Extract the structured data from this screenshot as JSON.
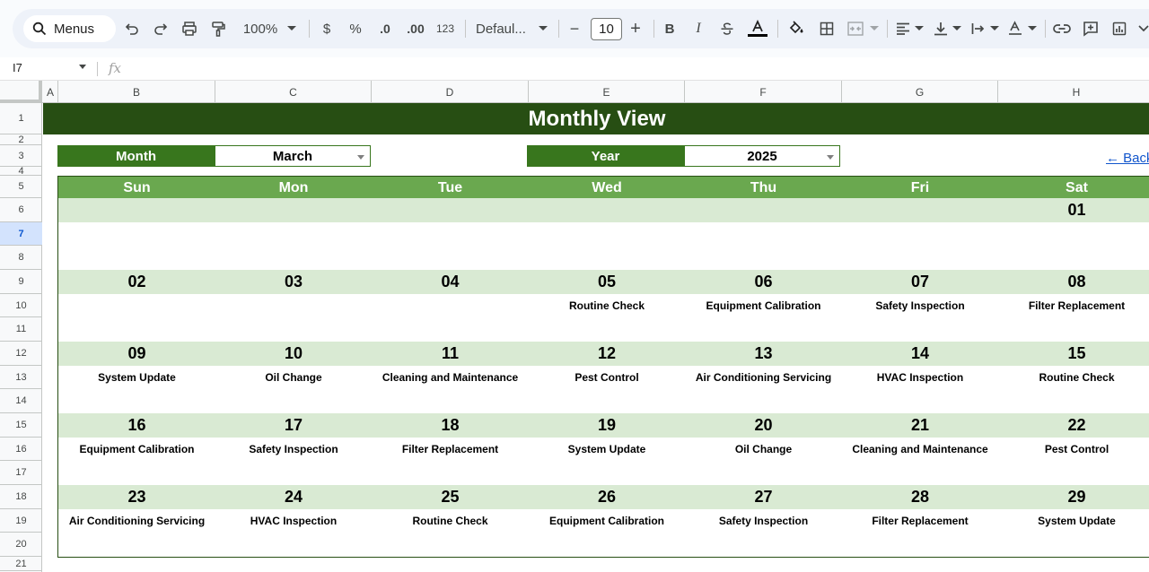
{
  "toolbar": {
    "menus_label": "Menus",
    "zoom": "100%",
    "currency": "$",
    "percent": "%",
    "decrease_decimal": ".0",
    "increase_decimal": ".00",
    "number_format": "123",
    "font_family": "Defaul...",
    "font_size": "10",
    "minus": "−",
    "plus": "+",
    "bold": "B",
    "italic": "I"
  },
  "formula_bar": {
    "name_box": "I7",
    "fx": "fx"
  },
  "columns": [
    "A",
    "B",
    "C",
    "D",
    "E",
    "F",
    "G",
    "H"
  ],
  "rows": [
    "1",
    "2",
    "3",
    "4",
    "5",
    "6",
    "7",
    "8",
    "9",
    "10",
    "11",
    "12",
    "13",
    "14",
    "15",
    "16",
    "17",
    "18",
    "19",
    "20",
    "21"
  ],
  "selected_row": "7",
  "sheet": {
    "title": "Monthly View",
    "month_label": "Month",
    "month_value": "March",
    "year_label": "Year",
    "year_value": "2025",
    "back_link": "← Back"
  },
  "calendar": {
    "days": [
      "Sun",
      "Mon",
      "Tue",
      "Wed",
      "Thu",
      "Fri",
      "Sat"
    ],
    "weeks": [
      {
        "dates": [
          "",
          "",
          "",
          "",
          "",
          "",
          "01"
        ],
        "events": [
          "",
          "",
          "",
          "",
          "",
          "",
          ""
        ]
      },
      {
        "dates": [
          "02",
          "03",
          "04",
          "05",
          "06",
          "07",
          "08"
        ],
        "events": [
          "",
          "",
          "",
          "Routine Check",
          "Equipment Calibration",
          "Safety Inspection",
          "Filter Replacement"
        ]
      },
      {
        "dates": [
          "09",
          "10",
          "11",
          "12",
          "13",
          "14",
          "15"
        ],
        "events": [
          "System Update",
          "Oil Change",
          "Cleaning and Maintenance",
          "Pest Control",
          "Air Conditioning Servicing",
          "HVAC Inspection",
          "Routine Check"
        ]
      },
      {
        "dates": [
          "16",
          "17",
          "18",
          "19",
          "20",
          "21",
          "22"
        ],
        "events": [
          "Equipment Calibration",
          "Safety Inspection",
          "Filter Replacement",
          "System Update",
          "Oil Change",
          "Cleaning and Maintenance",
          "Pest Control"
        ]
      },
      {
        "dates": [
          "23",
          "24",
          "25",
          "26",
          "27",
          "28",
          "29"
        ],
        "events": [
          "Air Conditioning Servicing",
          "HVAC Inspection",
          "Routine Check",
          "Equipment Calibration",
          "Safety Inspection",
          "Filter Replacement",
          "System Update"
        ]
      }
    ]
  },
  "colors": {
    "title_bg": "#274e13",
    "label_bg": "#38761d",
    "day_header_bg": "#6aa84f",
    "week_band_bg": "#d9ead3",
    "link": "#1155cc"
  }
}
